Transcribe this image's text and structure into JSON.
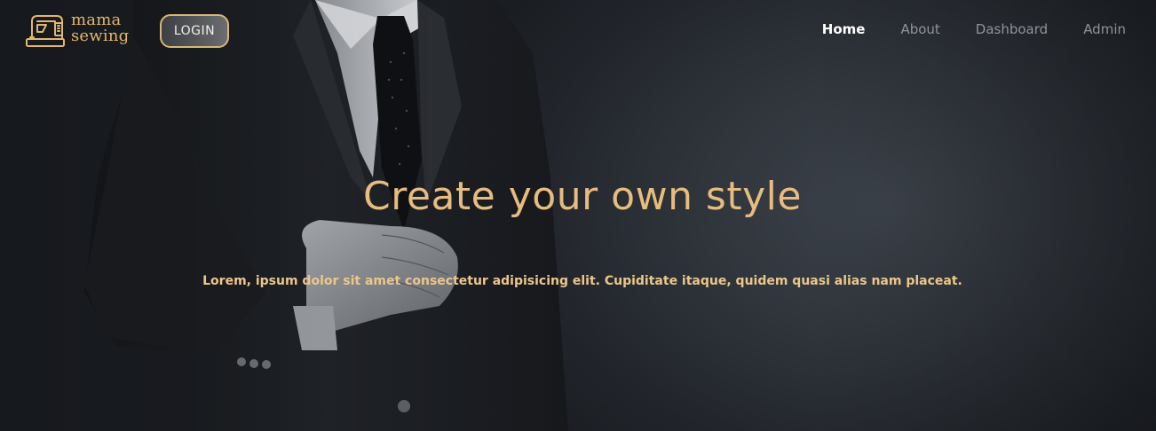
{
  "brand": {
    "name_line1": "mama",
    "name_line2": "sewing",
    "icon": "sewing-machine-icon",
    "color": "#e2b66e"
  },
  "header": {
    "login_label": "LOGIN",
    "nav": [
      {
        "label": "Home",
        "active": true
      },
      {
        "label": "About",
        "active": false
      },
      {
        "label": "Dashboard",
        "active": false
      },
      {
        "label": "Admin",
        "active": false
      }
    ]
  },
  "hero": {
    "title": "Create your own style",
    "subtitle": "Lorem, ipsum dolor sit amet consectetur adipisicing elit. Cupiditate itaque, quidem quasi alias nam placeat.",
    "accent_color": "#e6bc7f"
  }
}
